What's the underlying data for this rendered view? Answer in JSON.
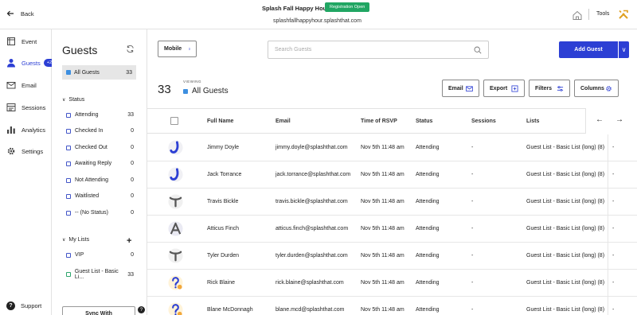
{
  "topbar": {
    "back_label": "Back",
    "event_title": "Splash Fall Happy Hour",
    "registration_badge": "Registration Open",
    "event_url": "splashfallhappyhour.splashthat.com",
    "tools_label": "Tools"
  },
  "nav": {
    "items": [
      {
        "label": "Event",
        "icon": "calendar-icon"
      },
      {
        "label": "Guests",
        "icon": "person-icon",
        "badge": "+23",
        "active": true
      },
      {
        "label": "Email",
        "icon": "envelope-icon"
      },
      {
        "label": "Sessions",
        "icon": "sessions-icon"
      },
      {
        "label": "Analytics",
        "icon": "bar-chart-icon"
      },
      {
        "label": "Settings",
        "icon": "gear-icon"
      }
    ],
    "support_label": "Support"
  },
  "filters": {
    "title": "Guests",
    "all_guests": {
      "label": "All Guests",
      "count": "33"
    },
    "status_header": "Status",
    "status": [
      {
        "label": "Attending",
        "count": "33"
      },
      {
        "label": "Checked In",
        "count": "0"
      },
      {
        "label": "Checked Out",
        "count": "0"
      },
      {
        "label": "Awaiting Reply",
        "count": "0"
      },
      {
        "label": "Not Attending",
        "count": "0"
      },
      {
        "label": "Waitlisted",
        "count": "0"
      },
      {
        "label": "-- (No Status)",
        "count": "0"
      }
    ],
    "lists_header": "My Lists",
    "lists": [
      {
        "label": "VIP",
        "count": "0"
      },
      {
        "label": "Guest List - Basic Li...",
        "count": "33"
      }
    ],
    "sync_label": "Sync With"
  },
  "toolbar": {
    "device_label": "Mobile",
    "search_placeholder": "Search Guests",
    "add_guest_label": "Add Guest",
    "count": "33",
    "viewing_label": "VIEWING",
    "viewing_name": "All Guests",
    "email_label": "Email",
    "export_label": "Export",
    "filters_label": "Filters",
    "columns_label": "Columns"
  },
  "table": {
    "headers": {
      "full_name": "Full Name",
      "email": "Email",
      "time": "Time of RSVP",
      "status": "Status",
      "sessions": "Sessions",
      "lists": "Lists"
    },
    "rows": [
      {
        "name": "Jimmy Doyle",
        "email": "jimmy.doyle@splashthat.com",
        "time": "Nov 5th 11:48 am",
        "status": "Attending",
        "sessions": "-",
        "lists": "Guest List - Basic List (long) (8)",
        "extra": "-",
        "avatar": "j-blue"
      },
      {
        "name": "Jack Torrance",
        "email": "jack.torrance@splashthat.com",
        "time": "Nov 5th 11:48 am",
        "status": "Attending",
        "sessions": "-",
        "lists": "Guest List - Basic List (long) (8)",
        "extra": "-",
        "avatar": "j-blue"
      },
      {
        "name": "Travis Bickle",
        "email": "travis.bickle@splashthat.com",
        "time": "Nov 5th 11:48 am",
        "status": "Attending",
        "sessions": "-",
        "lists": "Guest List - Basic List (long) (8)",
        "extra": "-",
        "avatar": "t-grey"
      },
      {
        "name": "Atticus Finch",
        "email": "atticus.finch@splashthat.com",
        "time": "Nov 5th 11:48 am",
        "status": "Attending",
        "sessions": "-",
        "lists": "Guest List - Basic List (long) (8)",
        "extra": "-",
        "avatar": "a-grey"
      },
      {
        "name": "Tyler Durden",
        "email": "tyler.durden@splashthat.com",
        "time": "Nov 5th 11:48 am",
        "status": "Attending",
        "sessions": "-",
        "lists": "Guest List - Basic List (long) (8)",
        "extra": "-",
        "avatar": "t-grey"
      },
      {
        "name": "Rick Blaine",
        "email": "rick.blaine@splashthat.com",
        "time": "Nov 5th 11:48 am",
        "status": "Attending",
        "sessions": "-",
        "lists": "Guest List - Basic List (long) (8)",
        "extra": "-",
        "avatar": "question"
      },
      {
        "name": "Blane McDonnagh",
        "email": "blane.mcd@splashthat.com",
        "time": "Nov 5th 11:48 am",
        "status": "Attending",
        "sessions": "-",
        "lists": "Guest List - Basic List (long) (8)",
        "extra": "-",
        "avatar": "question"
      }
    ]
  },
  "colors": {
    "accent": "#2c3fd4",
    "success": "#21a663",
    "all_guests_dot": "#3d8fe0"
  }
}
